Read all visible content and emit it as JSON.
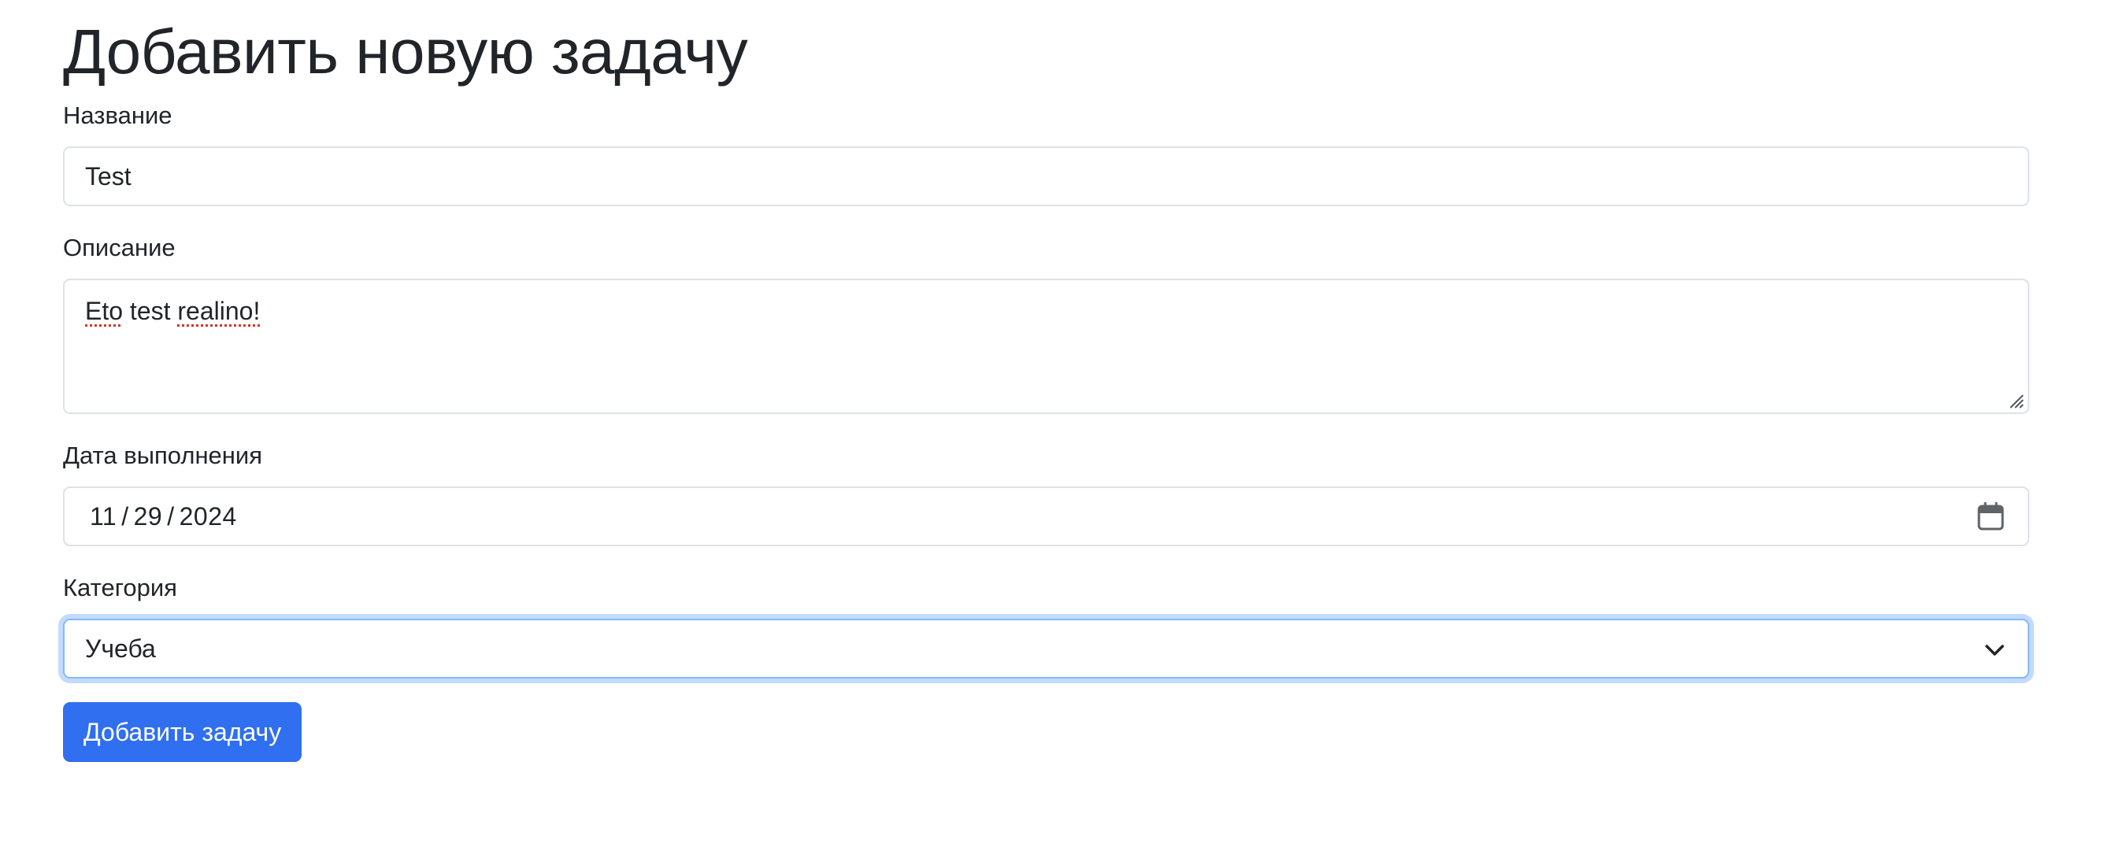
{
  "page": {
    "title": "Добавить новую задачу"
  },
  "form": {
    "name": {
      "label": "Название",
      "value": "Test"
    },
    "description": {
      "label": "Описание",
      "value_words": [
        "Eto",
        "test",
        "realino!"
      ]
    },
    "due_date": {
      "label": "Дата выполнения",
      "month": "11",
      "day": "29",
      "year": "2024",
      "icon": "calendar-icon"
    },
    "category": {
      "label": "Категория",
      "selected": "Учеба",
      "icon": "chevron-down-icon"
    },
    "submit_label": "Добавить задачу"
  },
  "colors": {
    "primary": "#2f6ff0",
    "focus_border": "#86b7fe",
    "input_border": "#dee2e6",
    "text": "#212529"
  }
}
